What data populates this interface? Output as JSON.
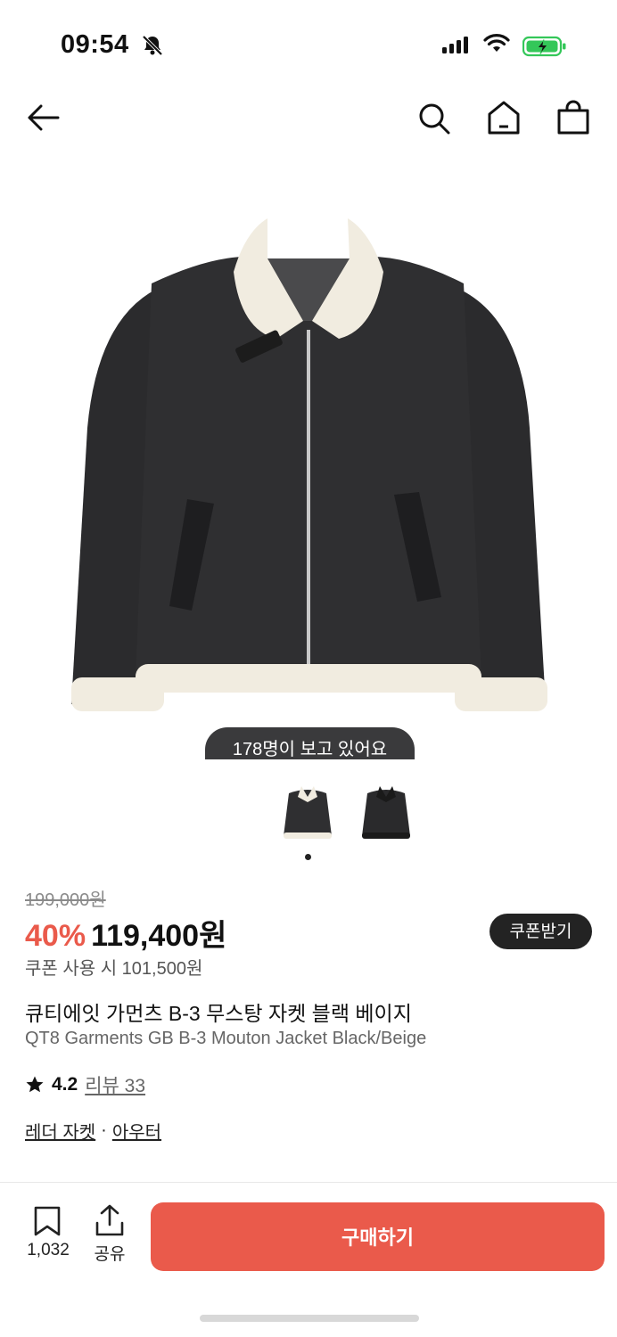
{
  "status_bar": {
    "time": "09:54",
    "battery_color": "#34c759"
  },
  "nav": {
    "back_icon": "arrow-left-icon",
    "search_icon": "search-icon",
    "home_icon": "home-icon",
    "cart_icon": "shopping-bag-icon"
  },
  "product": {
    "viewers_badge": "178명이 보고 있어요",
    "thumbnail_count": 2,
    "original_price": "199,000원",
    "discount": "40%",
    "sale_price": "119,400원",
    "coupon_button": "쿠폰받기",
    "coupon_price": "쿠폰 사용 시 101,500원",
    "name_ko": "큐티에잇 가먼츠 B-3 무스탕 자켓 블랙 베이지",
    "name_en": "QT8 Garments GB B-3 Mouton Jacket Black/Beige",
    "rating": "4.2",
    "reviews": "리뷰 33",
    "category_1": "레더 자켓",
    "category_sep": "·",
    "category_2": "아우터"
  },
  "bottom_bar": {
    "save_count": "1,032",
    "share_label": "공유",
    "buy_button": "구매하기"
  },
  "colors": {
    "accent": "#ea5a4b",
    "dark_button": "#232323"
  }
}
